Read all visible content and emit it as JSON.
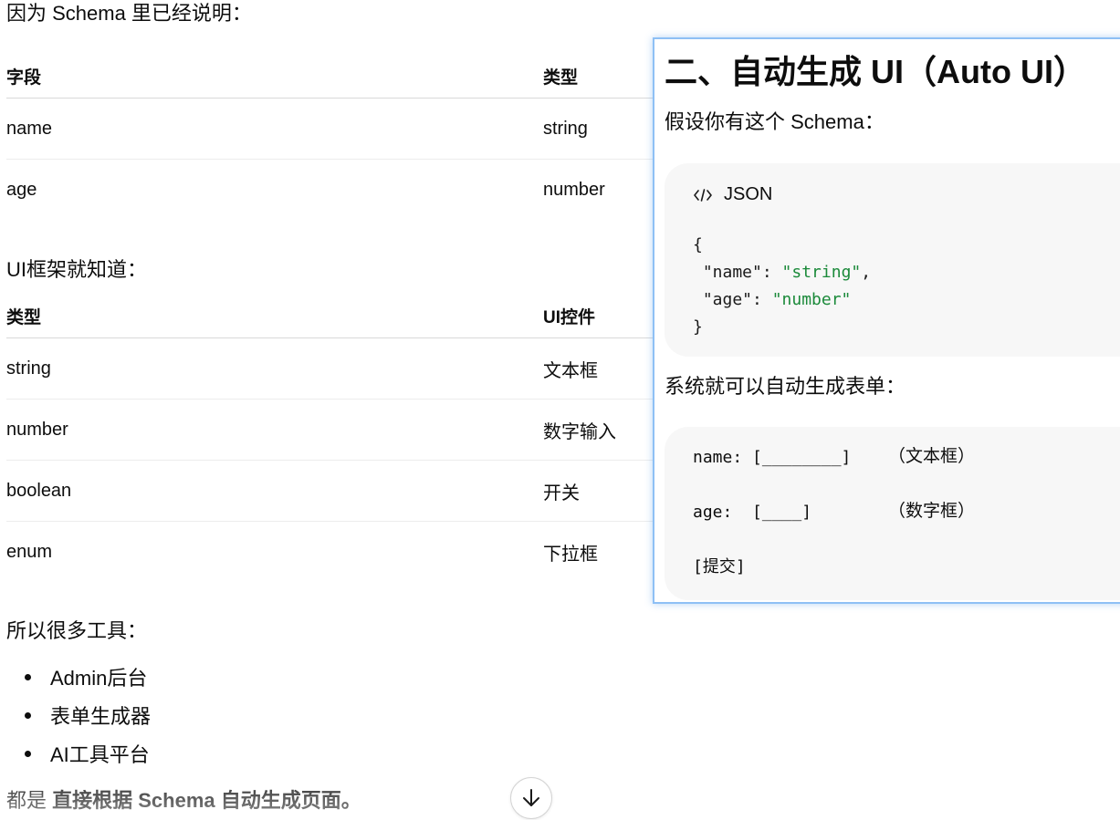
{
  "intro_text": "因为 Schema 里已经说明：",
  "schema_table": {
    "headers": [
      "字段",
      "类型"
    ],
    "rows": [
      [
        "name",
        "string"
      ],
      [
        "age",
        "number"
      ]
    ]
  },
  "ui_intro_text": "UI框架就知道：",
  "ui_table": {
    "headers": [
      "类型",
      "UI控件"
    ],
    "rows": [
      [
        "string",
        "文本框"
      ],
      [
        "number",
        "数字输入"
      ],
      [
        "boolean",
        "开关"
      ],
      [
        "enum",
        "下拉框"
      ]
    ]
  },
  "tools_intro_text": "所以很多工具：",
  "tools_list": [
    "Admin后台",
    "表单生成器",
    "AI工具平台"
  ],
  "bottom": {
    "prefix": "都是 ",
    "bold": "直接根据 Schema 自动生成页面。"
  },
  "scroll_button": {
    "icon": "arrow-down-icon"
  },
  "overlay": {
    "title": "二、自动生成 UI（Auto UI）",
    "p1": "假设你有这个 Schema：",
    "code_lang": "JSON",
    "code_icon": "code-icon",
    "json_lines": {
      "open": "{",
      "name_key": " \"name\": ",
      "name_val": "\"string\"",
      "name_comma": ",",
      "age_key": " \"age\": ",
      "age_val": "\"number\"",
      "close": "}"
    },
    "p2": "系统就可以自动生成表单：",
    "form": {
      "line1": "name: [________]",
      "note1": "（文本框）",
      "line2": "age:  [____]",
      "note2": "（数字框）",
      "line3": "[提交]"
    },
    "colors": {
      "string_color": "#1b8a3a",
      "border_color": "#8ec0f5"
    }
  }
}
